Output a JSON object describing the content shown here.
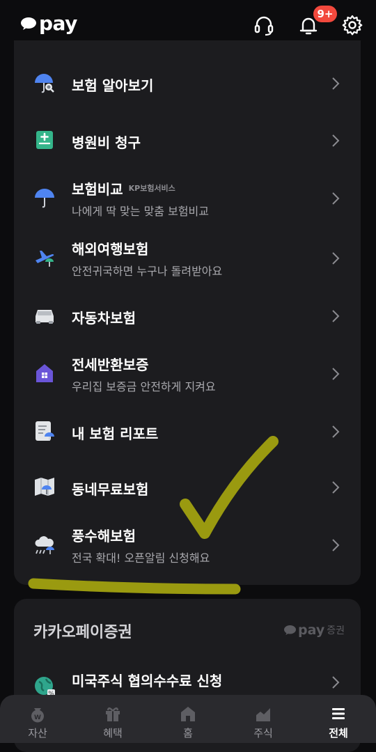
{
  "header": {
    "logo_text": "pay",
    "notification_badge": "9+",
    "icons": [
      "headset-icon",
      "bell-icon",
      "gear-icon"
    ]
  },
  "insurance_menu": [
    {
      "title": "보험 알아보기",
      "icon": "umbrella-search-icon"
    },
    {
      "title": "병원비 청구",
      "icon": "medical-clipboard-icon"
    },
    {
      "title": "보험비교",
      "tag": "KP보험서비스",
      "subtitle": "나에게 딱 맞는 맞춤 보험비교",
      "icon": "umbrella-icon"
    },
    {
      "title": "해외여행보험",
      "subtitle": "안전귀국하면 누구나 돌려받아요",
      "icon": "airplane-umbrella-icon"
    },
    {
      "title": "자동차보험",
      "icon": "car-icon"
    },
    {
      "title": "전세반환보증",
      "subtitle": "우리집 보증금 안전하게 지켜요",
      "icon": "house-icon"
    },
    {
      "title": "내 보험 리포트",
      "icon": "report-icon"
    },
    {
      "title": "동네무료보험",
      "icon": "map-umbrella-icon"
    },
    {
      "title": "풍수해보험",
      "subtitle": "전국 확대! 오픈알림 신청해요",
      "icon": "storm-cloud-icon"
    }
  ],
  "securities": {
    "title": "카카오페이증권",
    "brand_pay": "pay",
    "brand_suffix": "증권",
    "items": [
      {
        "title": "미국주식 협의수수료 신청",
        "icon": "globe-percent-icon"
      }
    ]
  },
  "tabbar": {
    "tabs": [
      {
        "label": "자산",
        "icon": "asset-icon"
      },
      {
        "label": "혜택",
        "icon": "gift-icon"
      },
      {
        "label": "홈",
        "icon": "home-icon"
      },
      {
        "label": "주식",
        "icon": "stock-chart-icon"
      },
      {
        "label": "전체",
        "icon": "menu-icon",
        "active": true
      }
    ]
  },
  "colors": {
    "background": "#0c0c0e",
    "card": "#1c1c1f",
    "badge": "#f2493d",
    "annotation": "#9a9a10"
  }
}
